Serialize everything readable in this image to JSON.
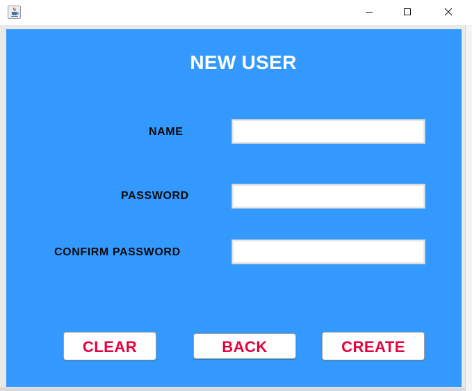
{
  "window": {
    "icon": "java-cup-icon",
    "controls": {
      "minimize_icon": "minimize-icon",
      "maximize_icon": "maximize-icon",
      "close_icon": "close-icon"
    }
  },
  "form": {
    "title": "NEW USER",
    "fields": {
      "name_label": "NAME",
      "name_value": "",
      "password_label": "PASSWORD",
      "password_value": "",
      "confirm_label": "CONFIRM PASSWORD",
      "confirm_value": ""
    },
    "buttons": {
      "clear": "CLEAR",
      "back": "BACK",
      "create": "CREATE"
    }
  },
  "colors": {
    "panel_background": "#3399ff",
    "title_text": "#ffffff",
    "label_text": "#0a0a0a",
    "button_text": "#e8003d",
    "button_background": "#ffffff"
  }
}
